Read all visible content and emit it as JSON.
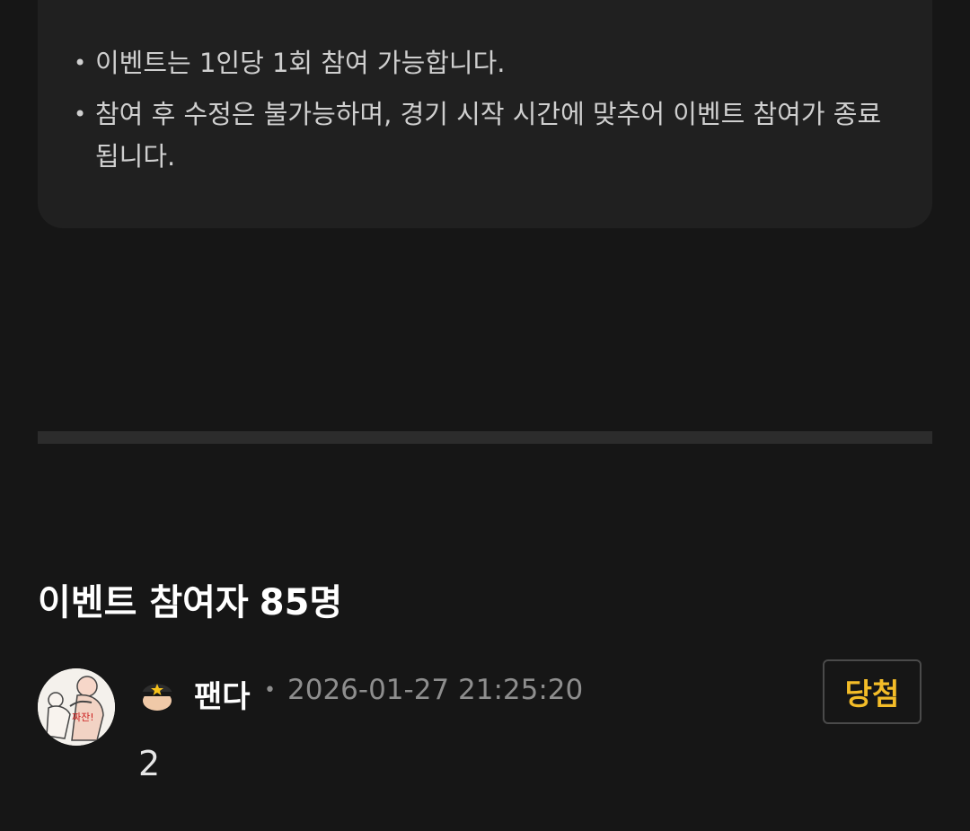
{
  "notice": {
    "items": [
      {
        "text": "이벤트는 1인당 1회 참여 가능합니다."
      },
      {
        "text": "참여 후 수정은 불가능하며, 경기 시작 시간에 맞추어 이벤트 참여가 종료됩니다."
      }
    ]
  },
  "participants": {
    "title": "이벤트 참여자",
    "count": "85명"
  },
  "entries": [
    {
      "username": "팬다",
      "timestamp": "2026-01-27 21:25:20",
      "answer": "2",
      "result_label": "당첨",
      "avatar_text": "짜잔!"
    }
  ],
  "colors": {
    "background": "#161616",
    "card": "#202020",
    "divider": "#2c2c2c",
    "winner_accent": "#f3bc28",
    "meta_text": "#8e8e8e"
  },
  "icons": {
    "level_badge": "police-cap-emoji-icon",
    "avatar": "cartoon-avatar-image"
  }
}
